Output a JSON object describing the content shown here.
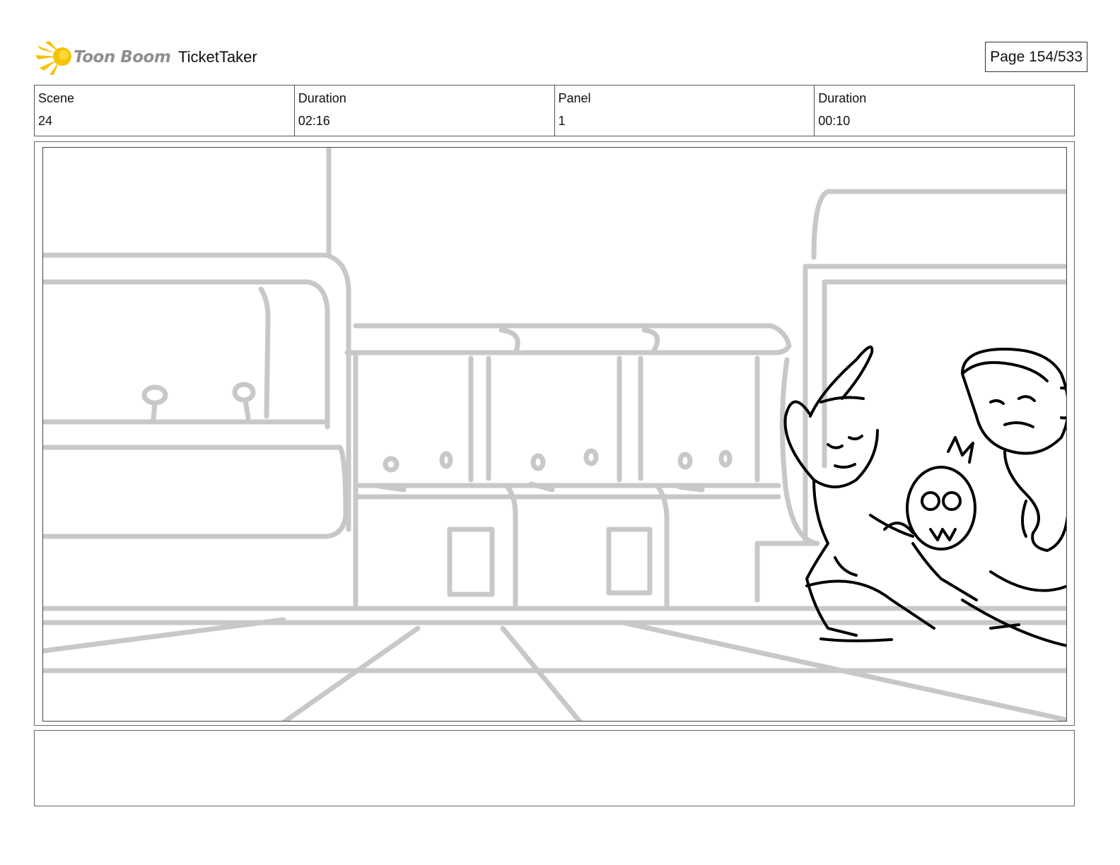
{
  "header": {
    "logo_text": "Toon Boom",
    "project_title": "TicketTaker",
    "page_counter": "Page 154/533"
  },
  "info": [
    {
      "label": "Scene",
      "value": "24"
    },
    {
      "label": "Duration",
      "value": "02:16"
    },
    {
      "label": "Panel",
      "value": "1"
    },
    {
      "label": "Duration",
      "value": "00:10"
    }
  ],
  "panel": {
    "icon": "storyboard-sketch"
  },
  "notes": {
    "text": ""
  },
  "colors": {
    "logo_yellow": "#f5c400",
    "logo_text": "#8f8f8f",
    "sketch_background": "#c8c8c8",
    "sketch_foreground": "#000000"
  }
}
